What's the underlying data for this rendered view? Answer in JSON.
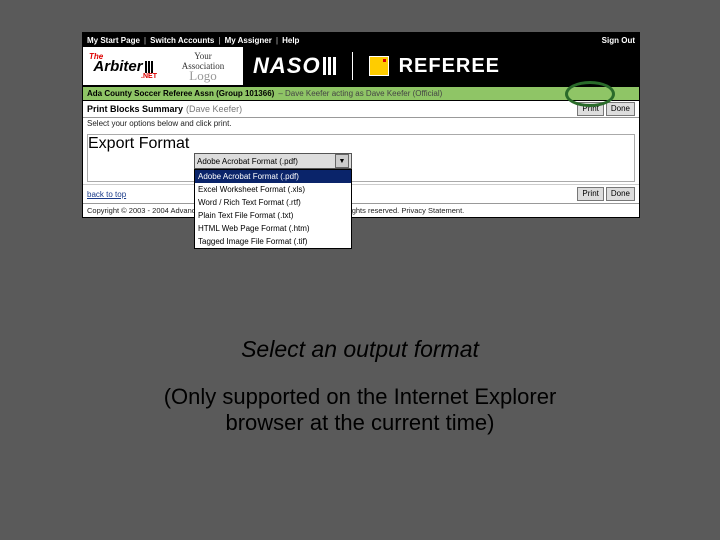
{
  "topnav": {
    "items": [
      "My Start Page",
      "Switch Accounts",
      "My Assigner",
      "Help"
    ],
    "signout": "Sign Out"
  },
  "logos": {
    "arbiter_the": "The",
    "arbiter_main": "Arbiter",
    "arbiter_net": ".NET",
    "assoc_l1": "Your",
    "assoc_l2": "Association",
    "assoc_l3": "Logo",
    "naso": "NASO",
    "referee": "REFEREE"
  },
  "greenbar": {
    "main": "Ada County Soccer Referee Assn (Group 101366)",
    "sub": "–  Dave Keefer acting as Dave Keefer (Official)"
  },
  "summary": {
    "title": "Print Blocks Summary",
    "subtitle": "(Dave Keefer)",
    "instruction": "Select your options below and click print.",
    "print": "Print",
    "done": "Done"
  },
  "export": {
    "legend": "Export Format",
    "selected": "Adobe Acrobat Format (.pdf)",
    "options": [
      "Adobe Acrobat Format (.pdf)",
      "Excel Worksheet Format (.xls)",
      "Word / Rich Text Format (.rtf)",
      "Plain Text File Format (.txt)",
      "HTML Web Page Format (.htm)",
      "Tagged Image File Format (.tif)"
    ]
  },
  "footer": {
    "back": "back to top",
    "copyright": "Copyright © 2003 - 2004 Advanced Business Software and The Arbiter.net.  All rights reserved. Privacy Statement."
  },
  "captions": {
    "line1": "Select an output format",
    "line2a": "(Only supported on the Internet Explorer",
    "line2b": "browser at the current time)"
  }
}
